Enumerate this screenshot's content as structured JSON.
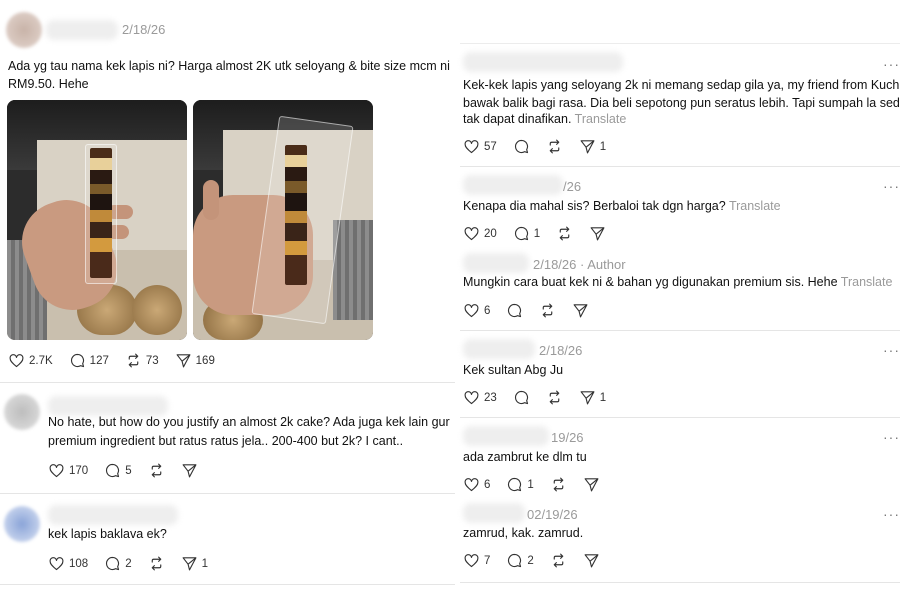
{
  "left": {
    "main_post": {
      "date": "2/18/26",
      "text_lines": [
        "Ada yg tau nama kek lapis ni? Harga almost 2K utk seloyang & bite size mcm ni",
        "RM9.50. Hehe"
      ],
      "likes": "2.7K",
      "replies": "127",
      "reposts": "73",
      "shares": "169"
    },
    "reply1": {
      "text_lines": [
        "No hate, but how do you justify an almost 2k cake? Ada juga kek lain gur",
        "premium ingredient but ratus ratus jela.. 200-400 but 2k? I cant.."
      ],
      "likes": "170",
      "replies": "5",
      "reposts": "",
      "shares": ""
    },
    "reply2": {
      "text_lines": [
        "kek lapis baklava ek?"
      ],
      "likes": "108",
      "replies": "2",
      "reposts": "",
      "shares": "1"
    }
  },
  "right": {
    "more_label": "···",
    "c1": {
      "text_lines": [
        "Kek-kek lapis yang seloyang 2k ni memang sedap gila ya, my friend from Kuching",
        "bawak balik bagi rasa. Dia beli sepotong pun seratus lebih. Tapi sumpah la sedap",
        "tak dapat dinafikan."
      ],
      "translate": "Translate",
      "likes": "57",
      "replies": "",
      "reposts": "",
      "shares": "1"
    },
    "c2": {
      "date_fragment": "/26",
      "text": "Kenapa dia mahal sis? Berbaloi tak dgn harga?",
      "translate": "Translate",
      "likes": "20",
      "replies": "1",
      "reposts": "",
      "shares": ""
    },
    "c3": {
      "date": "2/18/26",
      "author_tag": "· Author",
      "text": "Mungkin cara buat kek ni & bahan yg digunakan premium sis. Hehe",
      "translate": "Translate",
      "likes": "6",
      "replies": "",
      "reposts": "",
      "shares": ""
    },
    "c4": {
      "date": "2/18/26",
      "text": "Kek sultan Abg Ju",
      "likes": "23",
      "replies": "",
      "reposts": "",
      "shares": "1"
    },
    "c5": {
      "date": "19/26",
      "text": "ada zambrut ke dlm tu",
      "likes": "6",
      "replies": "1",
      "reposts": "",
      "shares": ""
    },
    "c6": {
      "date": "02/19/26",
      "text": "zamrud, kak. zamrud.",
      "likes": "7",
      "replies": "2",
      "reposts": "",
      "shares": ""
    }
  },
  "icons": [
    "heart-icon",
    "reply-icon",
    "repost-icon",
    "share-icon",
    "more-icon"
  ],
  "colors": {
    "muted": "#9a9a9a",
    "text": "#111111",
    "divider": "#e5e5e5"
  }
}
